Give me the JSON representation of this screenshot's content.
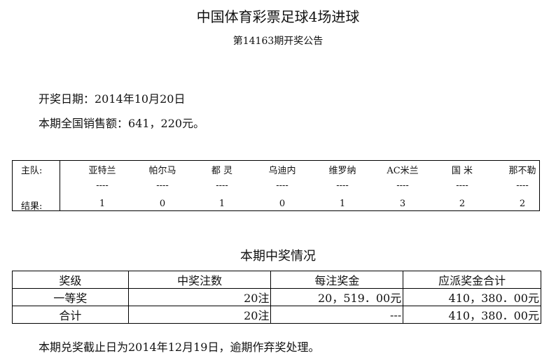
{
  "title": "中国体育彩票足球4场进球",
  "subtitle": "第14163期开奖公告",
  "draw_date": "开奖日期：2014年10月20日",
  "sales": "本期全国销售额：641，220元。",
  "matches": {
    "home_label": "主队:",
    "result_label": "结果:",
    "teams": [
      "亚特兰",
      "帕尔马",
      "都 灵",
      "乌迪内",
      "维罗纳",
      "AC米兰",
      "国 米",
      "那不勒"
    ],
    "separators": [
      "----",
      "----",
      "----",
      "----",
      "----",
      "----",
      "----",
      "----"
    ],
    "results": [
      "1",
      "0",
      "1",
      "0",
      "1",
      "3",
      "2",
      "2"
    ]
  },
  "section_title": "本期中奖情况",
  "prize_table": {
    "headers": [
      "奖级",
      "中奖注数",
      "每注奖金",
      "应派奖金合计"
    ],
    "rows": [
      [
        "一等奖",
        "20注",
        "20，519．00元",
        "410，380．00元"
      ],
      [
        "合计",
        "20注",
        "---",
        "410，380．00元"
      ]
    ]
  },
  "footer": "本期兑奖截止日为2014年12月19日，逾期作弃奖处理。"
}
